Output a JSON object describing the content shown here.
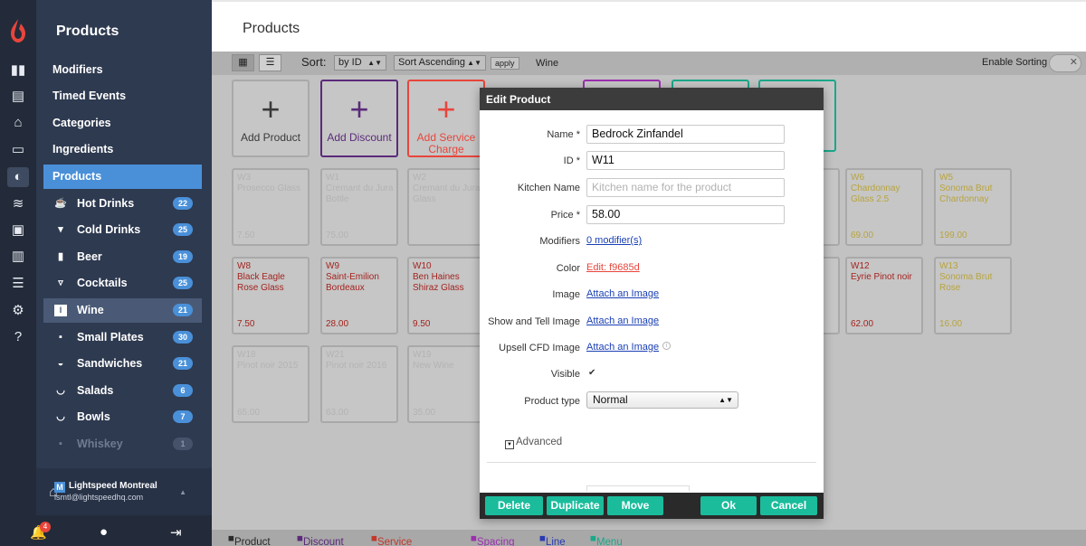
{
  "sidebar": {
    "title": "Products",
    "nav": [
      {
        "label": "Modifiers"
      },
      {
        "label": "Timed Events"
      },
      {
        "label": "Categories"
      },
      {
        "label": "Ingredients"
      },
      {
        "label": "Products"
      }
    ],
    "categories": [
      {
        "label": "Hot Drinks",
        "count": "22"
      },
      {
        "label": "Cold Drinks",
        "count": "25"
      },
      {
        "label": "Beer",
        "count": "19"
      },
      {
        "label": "Cocktails",
        "count": "25"
      },
      {
        "label": "Wine",
        "count": "21"
      },
      {
        "label": "Small Plates",
        "count": "30"
      },
      {
        "label": "Sandwiches",
        "count": "21"
      },
      {
        "label": "Salads",
        "count": "6"
      },
      {
        "label": "Bowls",
        "count": "7"
      },
      {
        "label": "Whiskey",
        "count": "1"
      }
    ],
    "account": {
      "badge": "M",
      "name": "Lightspeed Montreal",
      "email": "lsmtl@lightspeedhq.com"
    },
    "notification_count": "4"
  },
  "header": {
    "title": "Products"
  },
  "toolbar": {
    "sort_label": "Sort:",
    "sort_by": "by ID",
    "sort_order": "Sort Ascending",
    "apply": "apply",
    "category": "Wine",
    "enable_sorting": "Enable Sorting",
    "toggle_glyph": "✕"
  },
  "add_tiles": [
    {
      "label": "Add Product",
      "color": "#3a3a3a"
    },
    {
      "label": "Add Discount",
      "color": "#5b2a7a"
    },
    {
      "label": "Add Service Charge",
      "color": "#e8453c"
    }
  ],
  "tiles": [
    {
      "id": "W3",
      "name": "Prosecco Glass",
      "price": "7.50",
      "style": "faint"
    },
    {
      "id": "W1",
      "name": "Cremant du Jura Bottle",
      "price": "75.00",
      "style": "faint"
    },
    {
      "id": "W2",
      "name": "Cremant du Jura Glass",
      "price": "",
      "style": "faint"
    },
    {
      "id": "W6",
      "name": "Chardonnay Glass 2.5",
      "price": "69.00",
      "style": "gold"
    },
    {
      "id": "W5",
      "name": "Sonoma Brut Chardonnay",
      "price": "199.00",
      "style": "gold"
    },
    {
      "id": "W8",
      "name": "Black Eagle Rose Glass",
      "price": "7.50",
      "style": "red"
    },
    {
      "id": "W9",
      "name": "Saint-Emilion Bordeaux",
      "price": "28.00",
      "style": "red"
    },
    {
      "id": "W10",
      "name": "Ben Haines Shiraz Glass",
      "price": "9.50",
      "style": "red"
    },
    {
      "id": "W12",
      "name": "Eyrie Pinot noir",
      "price": "62.00",
      "style": "red"
    },
    {
      "id": "W13",
      "name": "Sonoma Brut Rose",
      "price": "16.00",
      "style": "gold"
    },
    {
      "id": "W18",
      "name": "Pinot noir 2015",
      "price": "65.00",
      "style": "faint"
    },
    {
      "id": "W21",
      "name": "Pinot noir 2016",
      "price": "63.00",
      "style": "faint"
    },
    {
      "id": "W19",
      "name": "New Wine",
      "price": "35.00",
      "style": "faint"
    }
  ],
  "legend": [
    {
      "label": "Product",
      "color": "#2a2a2a"
    },
    {
      "label": "Discount",
      "color": "#5b2a7a"
    },
    {
      "label": "Service Charge",
      "color": "#c0392b"
    },
    {
      "label": "Spacing",
      "color": "#9b2fae"
    },
    {
      "label": "Line",
      "color": "#2a3ab0"
    },
    {
      "label": "Menu",
      "color": "#1aa88a"
    }
  ],
  "modal": {
    "title": "Edit Product",
    "fields": {
      "name_label": "Name *",
      "name_value": "Bedrock Zinfandel",
      "id_label": "ID *",
      "id_value": "W11",
      "kitchen_label": "Kitchen Name",
      "kitchen_placeholder": "Kitchen name for the product",
      "price_label": "Price *",
      "price_value": "58.00",
      "modifiers_label": "Modifiers",
      "modifiers_link": "0 modifier(s)",
      "color_label": "Color",
      "color_link": "Edit: f9685d",
      "image_label": "Image",
      "image_link": "Attach an Image",
      "showtell_label": "Show and Tell Image",
      "showtell_link": "Attach an Image",
      "upsell_label": "Upsell CFD Image",
      "upsell_link": "Attach an Image",
      "visible_label": "Visible",
      "type_label": "Product type",
      "type_value": "Normal"
    },
    "advanced": "Advanced",
    "buttons": {
      "delete": "Delete",
      "duplicate": "Duplicate",
      "move": "Move",
      "ok": "Ok",
      "cancel": "Cancel"
    }
  }
}
